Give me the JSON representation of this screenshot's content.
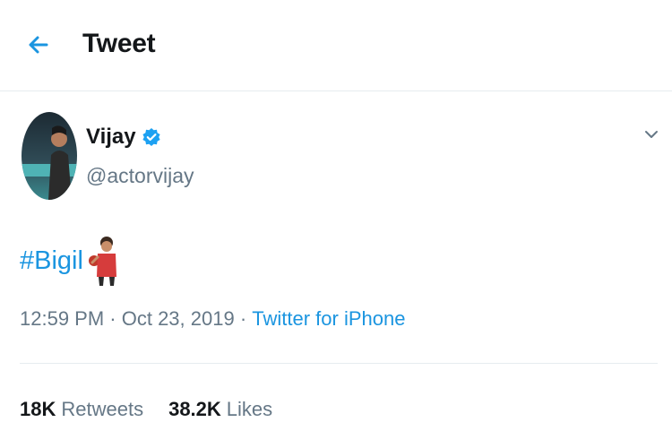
{
  "header": {
    "back_icon": "arrow-left-icon",
    "title": "Tweet"
  },
  "tweet": {
    "display_name": "Vijay",
    "verified_icon": "verified-badge-icon",
    "handle": "@actorvijay",
    "menu_icon": "chevron-down-icon",
    "hashtag": "#Bigil",
    "emoji_icon": "bigil-player-emoji-icon",
    "time": "12:59 PM",
    "separator": " · ",
    "date": "Oct 23, 2019",
    "source": "Twitter for iPhone"
  },
  "stats": {
    "retweets_count": "18K",
    "retweets_label": "Retweets",
    "likes_count": "38.2K",
    "likes_label": "Likes"
  },
  "colors": {
    "accent": "#1b95e0",
    "secondary_text": "#657786",
    "primary_text": "#14171a",
    "border": "#e6ecf0"
  }
}
